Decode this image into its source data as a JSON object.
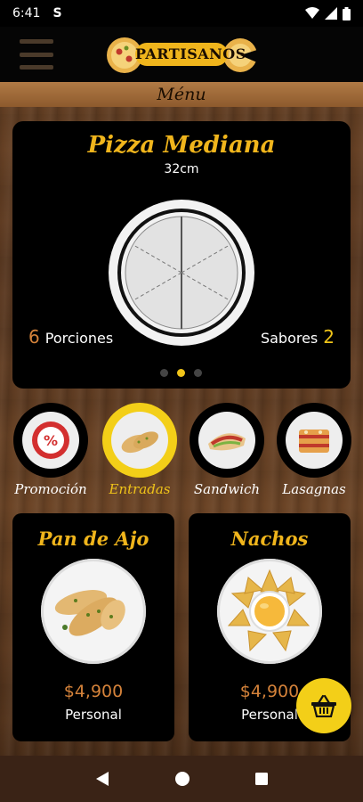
{
  "status_bar": {
    "time": "6:41",
    "app_icon": "S"
  },
  "header": {
    "logo_text": "PARTISANOS",
    "menu_icon": "hamburger-icon"
  },
  "section_title": "Ménu",
  "pizza_card": {
    "title": "Pizza Mediana",
    "size": "32cm",
    "portions_count": "6",
    "portions_label": "Porciones",
    "flavors_label": "Sabores",
    "flavors_count": "2",
    "carousel_active_index": 1
  },
  "categories": [
    {
      "label": "Promoción",
      "active": false,
      "icon": "discount-badge-icon"
    },
    {
      "label": "Entradas",
      "active": true,
      "icon": "garlic-bread-icon"
    },
    {
      "label": "Sandwich",
      "active": false,
      "icon": "sandwich-icon"
    },
    {
      "label": "Lasagnas",
      "active": false,
      "icon": "lasagna-icon"
    }
  ],
  "products": [
    {
      "name": "Pan de Ajo",
      "price": "$4,900",
      "size": "Personal"
    },
    {
      "name": "Nachos",
      "price": "$4,900",
      "size": "Personal"
    }
  ],
  "colors": {
    "accent": "#f0b51c",
    "price": "#d4823a",
    "active_ring": "#f3cf18"
  }
}
